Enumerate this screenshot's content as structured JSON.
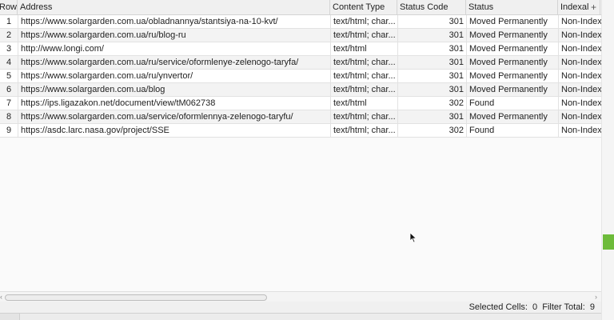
{
  "columns": [
    "Row",
    "Address",
    "Content Type",
    "Status Code",
    "Status",
    "Indexal"
  ],
  "add_column_glyph": "+",
  "rows": [
    {
      "row": "1",
      "address": "https://www.solargarden.com.ua/obladnannya/stantsiya-na-10-kvt/",
      "content_type": "text/html; char...",
      "status_code": "301",
      "status": "Moved Permanently",
      "indexability": "Non-Index"
    },
    {
      "row": "2",
      "address": "https://www.solargarden.com.ua/ru/blog-ru",
      "content_type": "text/html; char...",
      "status_code": "301",
      "status": "Moved Permanently",
      "indexability": "Non-Index"
    },
    {
      "row": "3",
      "address": "http://www.longi.com/",
      "content_type": "text/html",
      "status_code": "301",
      "status": "Moved Permanently",
      "indexability": "Non-Index"
    },
    {
      "row": "4",
      "address": "https://www.solargarden.com.ua/ru/service/oformlenye-zelenogo-taryfa/",
      "content_type": "text/html; char...",
      "status_code": "301",
      "status": "Moved Permanently",
      "indexability": "Non-Index"
    },
    {
      "row": "5",
      "address": "https://www.solargarden.com.ua/ru/ynvertor/",
      "content_type": "text/html; char...",
      "status_code": "301",
      "status": "Moved Permanently",
      "indexability": "Non-Index"
    },
    {
      "row": "6",
      "address": "https://www.solargarden.com.ua/blog",
      "content_type": "text/html; char...",
      "status_code": "301",
      "status": "Moved Permanently",
      "indexability": "Non-Index"
    },
    {
      "row": "7",
      "address": "https://ips.ligazakon.net/document/view/tM062738",
      "content_type": "text/html",
      "status_code": "302",
      "status": "Found",
      "indexability": "Non-Index"
    },
    {
      "row": "8",
      "address": "https://www.solargarden.com.ua/service/oformlennya-zelenogo-taryfu/",
      "content_type": "text/html; char...",
      "status_code": "301",
      "status": "Moved Permanently",
      "indexability": "Non-Index"
    },
    {
      "row": "9",
      "address": "https://asdc.larc.nasa.gov/project/SSE",
      "content_type": "text/html; char...",
      "status_code": "302",
      "status": "Found",
      "indexability": "Non-Index"
    }
  ],
  "status_bar": {
    "selected_label": "Selected Cells:",
    "selected_value": "0",
    "filter_label": "Filter Total:",
    "filter_value": "9"
  },
  "scroll": {
    "left_arrow": "‹",
    "right_arrow": "›"
  },
  "colors": {
    "scroll_accent": "#6dbb3a"
  }
}
